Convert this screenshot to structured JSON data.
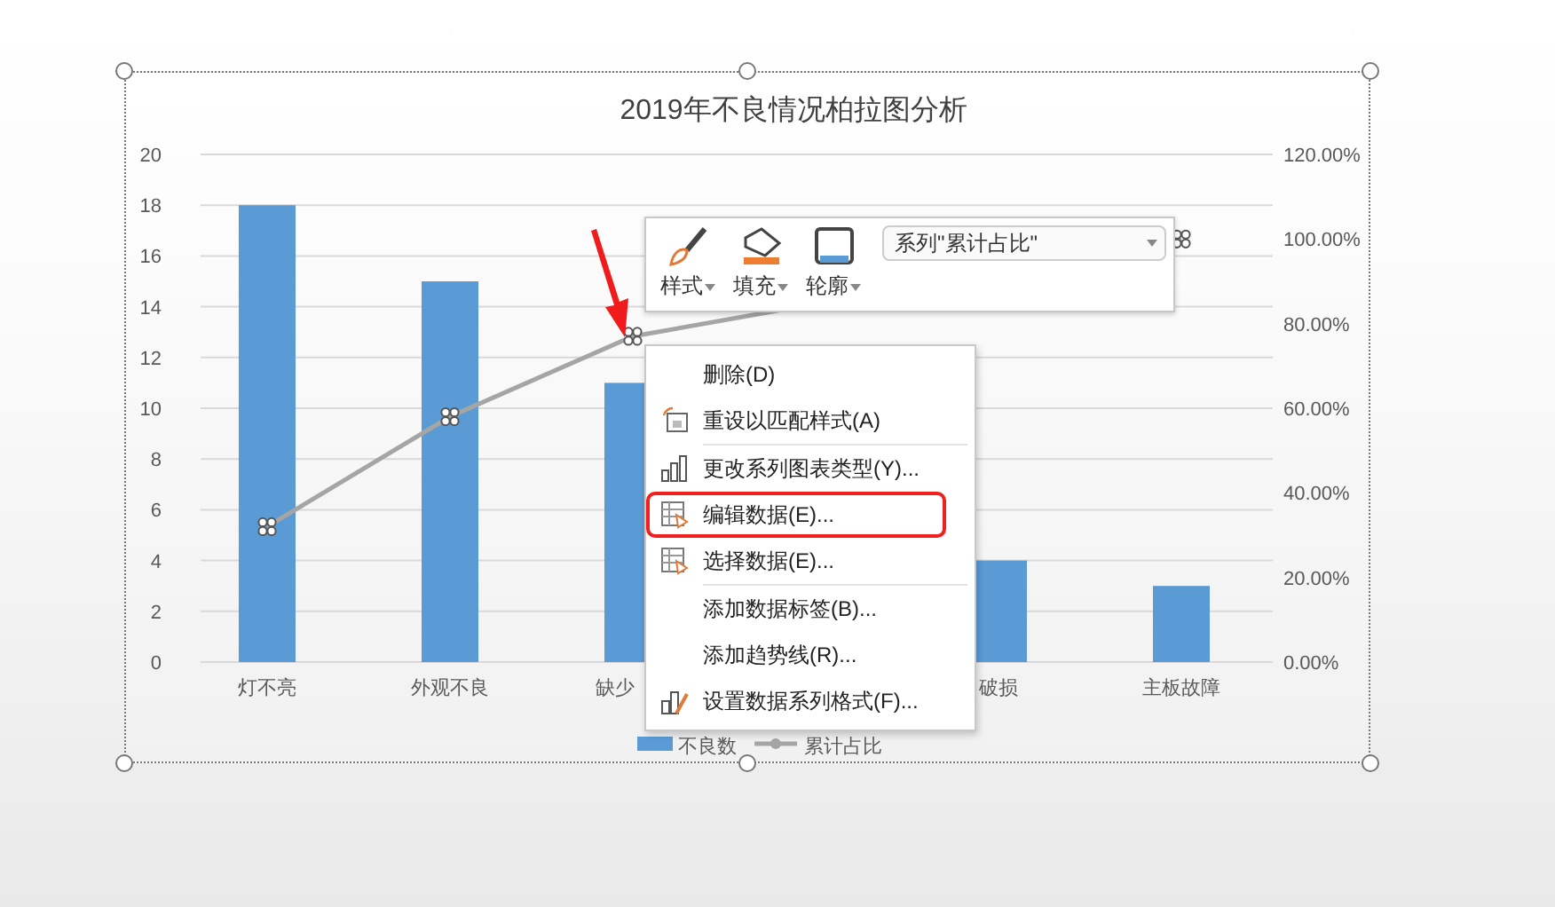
{
  "chart": {
    "chart_data": {
      "type": "bar",
      "title": "2019年不良情况柏拉图分析",
      "categories": [
        "灯不亮",
        "外观不良",
        "缺少",
        null,
        "破损",
        "主板故障"
      ],
      "series": [
        {
          "name": "不良数",
          "color": "#5b9bd5",
          "values": [
            18,
            15,
            11,
            null,
            4,
            3
          ]
        },
        {
          "name": "累计占比",
          "type": "line",
          "axis": "y2",
          "color": "#a5a5a5",
          "values": [
            0.32,
            0.58,
            0.77,
            null,
            null,
            1.0
          ]
        }
      ],
      "legend": true,
      "grid": true,
      "ylim": [
        0,
        20
      ],
      "y2lim": [
        0,
        1.2
      ],
      "yticks": [
        0,
        2,
        4,
        6,
        8,
        10,
        12,
        14,
        16,
        18,
        20
      ],
      "y2ticks": [
        {
          "value": 0,
          "label": "0.00%"
        },
        {
          "value": 0.2,
          "label": "20.00%"
        },
        {
          "value": 0.4,
          "label": "40.00%"
        },
        {
          "value": 0.6,
          "label": "60.00%"
        },
        {
          "value": 0.8,
          "label": "80.00%"
        },
        {
          "value": 1.0,
          "label": "100.00%"
        },
        {
          "value": 1.2,
          "label": "120.00%"
        }
      ]
    }
  },
  "toolbar": {
    "buttons": [
      {
        "label": "样式",
        "kind": "brush"
      },
      {
        "label": "填充",
        "kind": "fill"
      },
      {
        "label": "轮廓",
        "kind": "outline"
      }
    ],
    "series_select": {
      "value": "系列\"累计占比\""
    }
  },
  "context_menu": {
    "items": [
      {
        "label": "删除(D)",
        "kind": "plain",
        "separator_after": false,
        "highlighted": false
      },
      {
        "label": "重设以匹配样式(A)",
        "kind": "reset",
        "separator_after": true,
        "highlighted": false
      },
      {
        "label": "更改系列图表类型(Y)...",
        "kind": "chart-type",
        "separator_after": false,
        "highlighted": false
      },
      {
        "label": "编辑数据(E)...",
        "kind": "table",
        "separator_after": false,
        "highlighted": true
      },
      {
        "label": "选择数据(E)...",
        "kind": "table",
        "separator_after": true,
        "highlighted": false
      },
      {
        "label": "添加数据标签(B)...",
        "kind": "plain",
        "separator_after": false,
        "highlighted": false
      },
      {
        "label": "添加趋势线(R)...",
        "kind": "plain",
        "separator_after": false,
        "highlighted": false
      },
      {
        "label": "设置数据系列格式(F)...",
        "kind": "format",
        "separator_after": false,
        "highlighted": false
      }
    ]
  }
}
